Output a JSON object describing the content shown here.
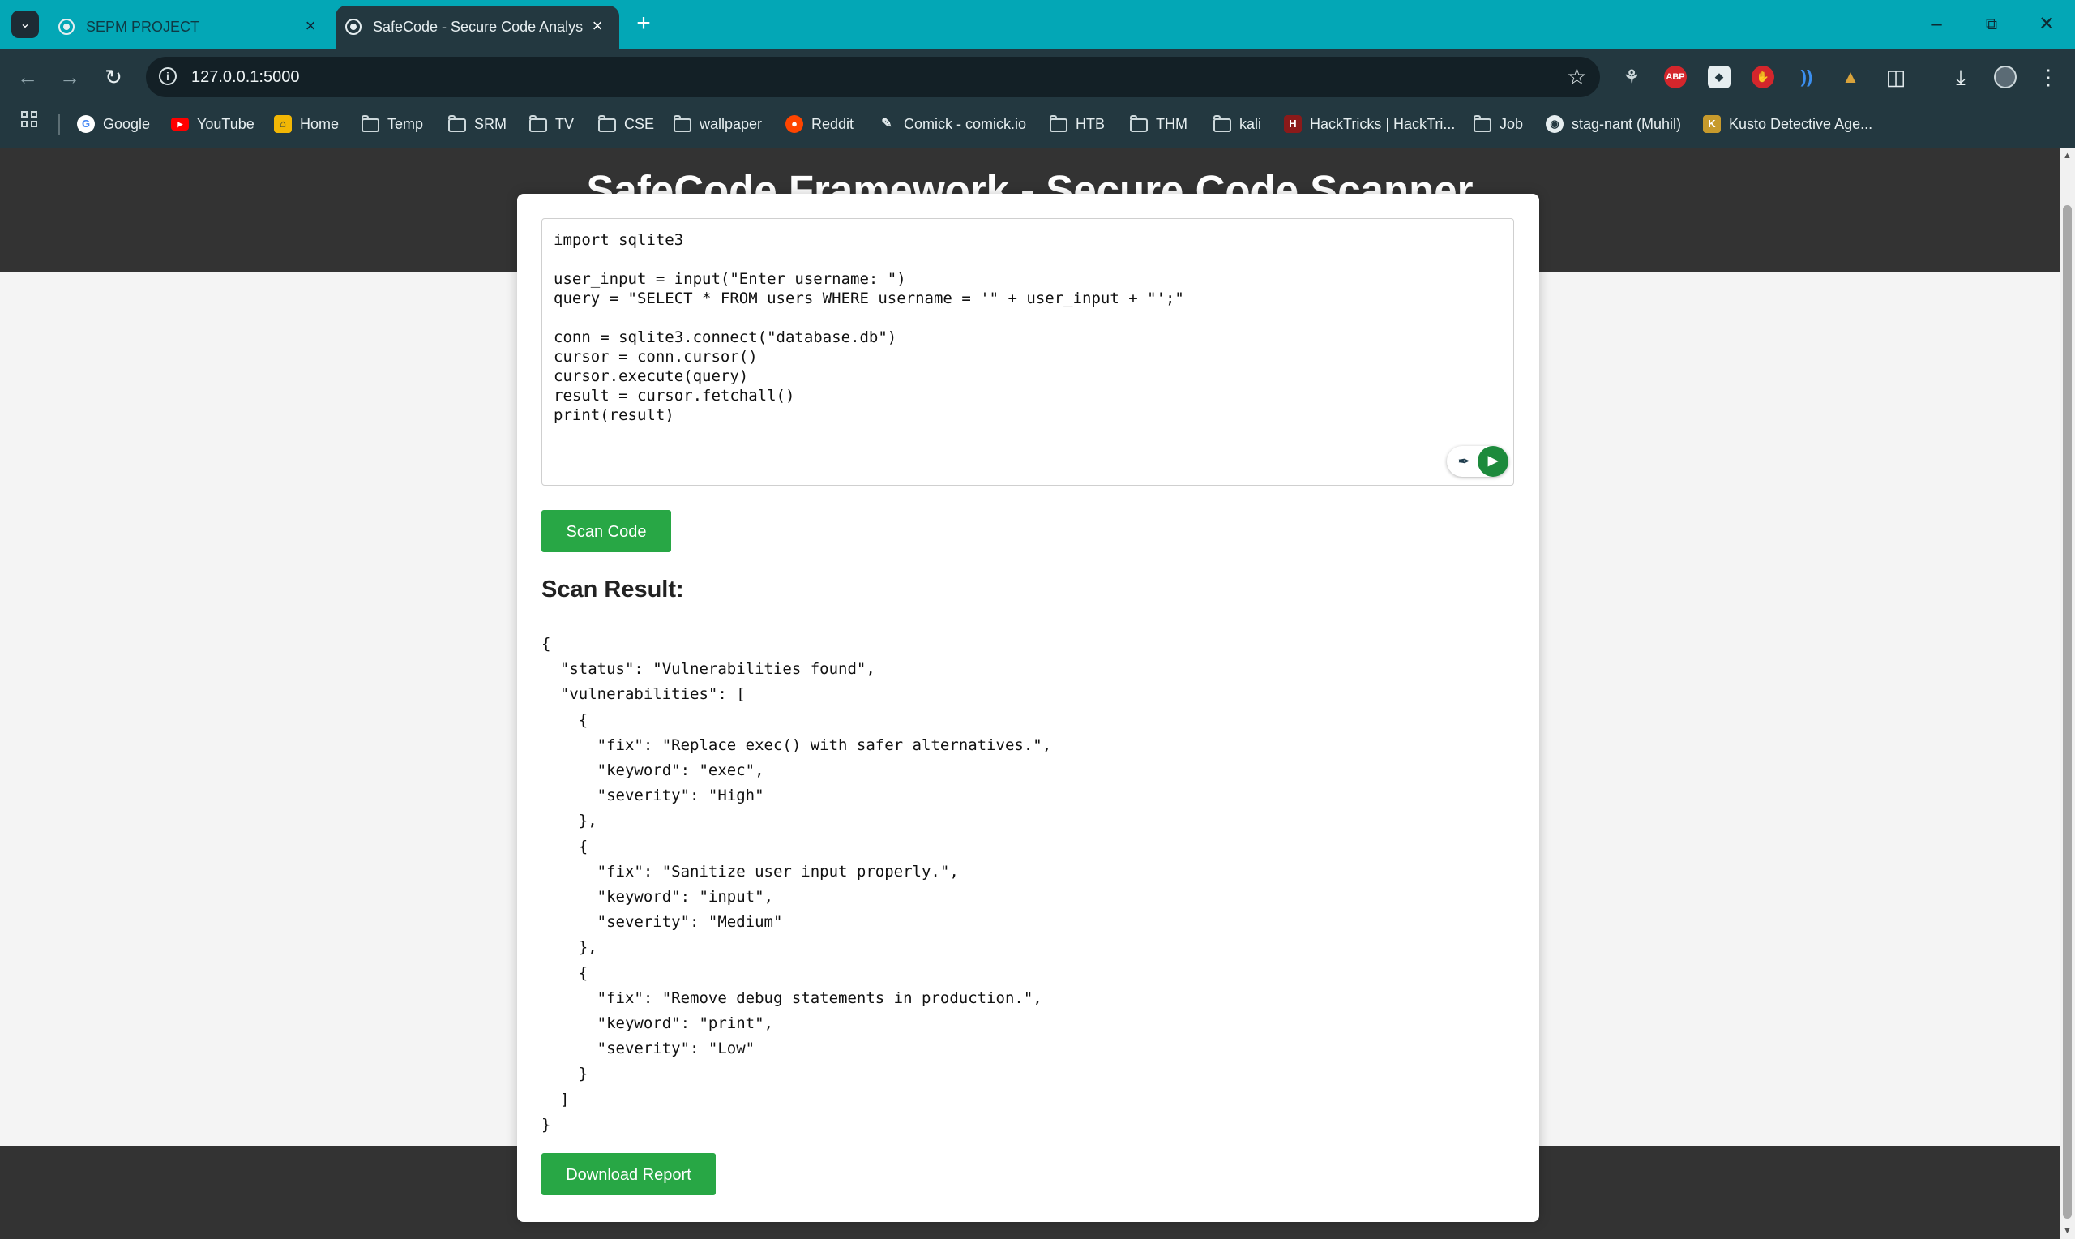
{
  "browser": {
    "tabs": [
      {
        "title": "SEPM PROJECT",
        "active": false
      },
      {
        "title": "SafeCode - Secure Code Analys",
        "active": true
      }
    ],
    "url": "127.0.0.1:5000",
    "extensions": {
      "abp": "ABP"
    },
    "bookmarks": [
      {
        "label": "Google",
        "icon": "google-icon"
      },
      {
        "label": "YouTube",
        "icon": "youtube-icon"
      },
      {
        "label": "Home",
        "icon": "home-icon"
      },
      {
        "label": "Temp",
        "icon": "folder-icon"
      },
      {
        "label": "SRM",
        "icon": "folder-icon"
      },
      {
        "label": "TV",
        "icon": "folder-icon"
      },
      {
        "label": "CSE",
        "icon": "folder-icon"
      },
      {
        "label": "wallpaper",
        "icon": "folder-icon"
      },
      {
        "label": "Reddit",
        "icon": "reddit-icon"
      },
      {
        "label": "Comick - comick.io",
        "icon": "comick-icon"
      },
      {
        "label": "HTB",
        "icon": "folder-icon"
      },
      {
        "label": "THM",
        "icon": "folder-icon"
      },
      {
        "label": "kali",
        "icon": "folder-icon"
      },
      {
        "label": "HackTricks | HackTri...",
        "icon": "hacktricks-icon"
      },
      {
        "label": "Job",
        "icon": "folder-icon"
      },
      {
        "label": "stag-nant (Muhil)",
        "icon": "github-icon"
      },
      {
        "label": "Kusto Detective Age...",
        "icon": "kusto-icon"
      }
    ]
  },
  "page": {
    "title": "SafeCode Framework - Secure Code Scanner",
    "code": "import sqlite3\n\nuser_input = input(\"Enter username: \")\nquery = \"SELECT * FROM users WHERE username = '\" + user_input + \"';\"\n\nconn = sqlite3.connect(\"database.db\")\ncursor = conn.cursor()\ncursor.execute(query)\nresult = cursor.fetchall()\nprint(result)",
    "scan_button": "Scan Code",
    "result_heading": "Scan Result:",
    "scan_result_text": "{\n  \"status\": \"Vulnerabilities found\",\n  \"vulnerabilities\": [\n    {\n      \"fix\": \"Replace exec() with safer alternatives.\",\n      \"keyword\": \"exec\",\n      \"severity\": \"High\"\n    },\n    {\n      \"fix\": \"Sanitize user input properly.\",\n      \"keyword\": \"input\",\n      \"severity\": \"Medium\"\n    },\n    {\n      \"fix\": \"Remove debug statements in production.\",\n      \"keyword\": \"print\",\n      \"severity\": \"Low\"\n    }\n  ]\n}",
    "download_button": "Download Report"
  },
  "colors": {
    "tab_strip": "#03a7b6",
    "toolbar": "#233840",
    "page_header": "#333333",
    "button_green": "#28a745"
  }
}
